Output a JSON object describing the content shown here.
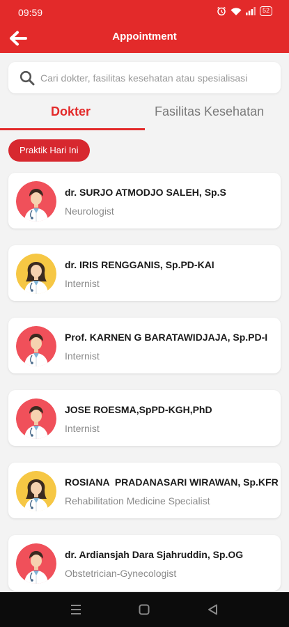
{
  "status_bar": {
    "time": "09:59",
    "battery": "52"
  },
  "app_bar": {
    "title": "Appointment"
  },
  "search": {
    "placeholder": "Cari dokter, fasilitas kesehatan atau spesialisasi"
  },
  "tabs": [
    {
      "label": "Dokter",
      "active": true
    },
    {
      "label": "Fasilitas Kesehatan",
      "active": false
    }
  ],
  "filter": {
    "label": "Praktik Hari Ini"
  },
  "colors": {
    "primary": "#e32a2a",
    "avatar_male_bg": "#f0505a",
    "avatar_female_bg": "#f6c744"
  },
  "doctors": [
    {
      "name": "dr. SURJO ATMODJO SALEH, Sp.S",
      "specialty": "Neurologist",
      "avatar": "male-doctor"
    },
    {
      "name": "dr. IRIS RENGGANIS, Sp.PD-KAI",
      "specialty": "Internist",
      "avatar": "female-doctor"
    },
    {
      "name": "Prof. KARNEN G BARATAWIDJAJA, Sp.PD-I",
      "specialty": "Internist",
      "avatar": "male-doctor"
    },
    {
      "name": "JOSE ROESMA,SpPD-KGH,PhD",
      "specialty": "Internist",
      "avatar": "male-doctor"
    },
    {
      "name": "ROSIANA  PRADANASARI WIRAWAN, Sp.KFR",
      "specialty": "Rehabilitation Medicine Specialist",
      "avatar": "female-doctor"
    },
    {
      "name": "dr. Ardiansjah Dara Sjahruddin, Sp.OG",
      "specialty": "Obstetrician-Gynecologist",
      "avatar": "male-doctor"
    }
  ]
}
